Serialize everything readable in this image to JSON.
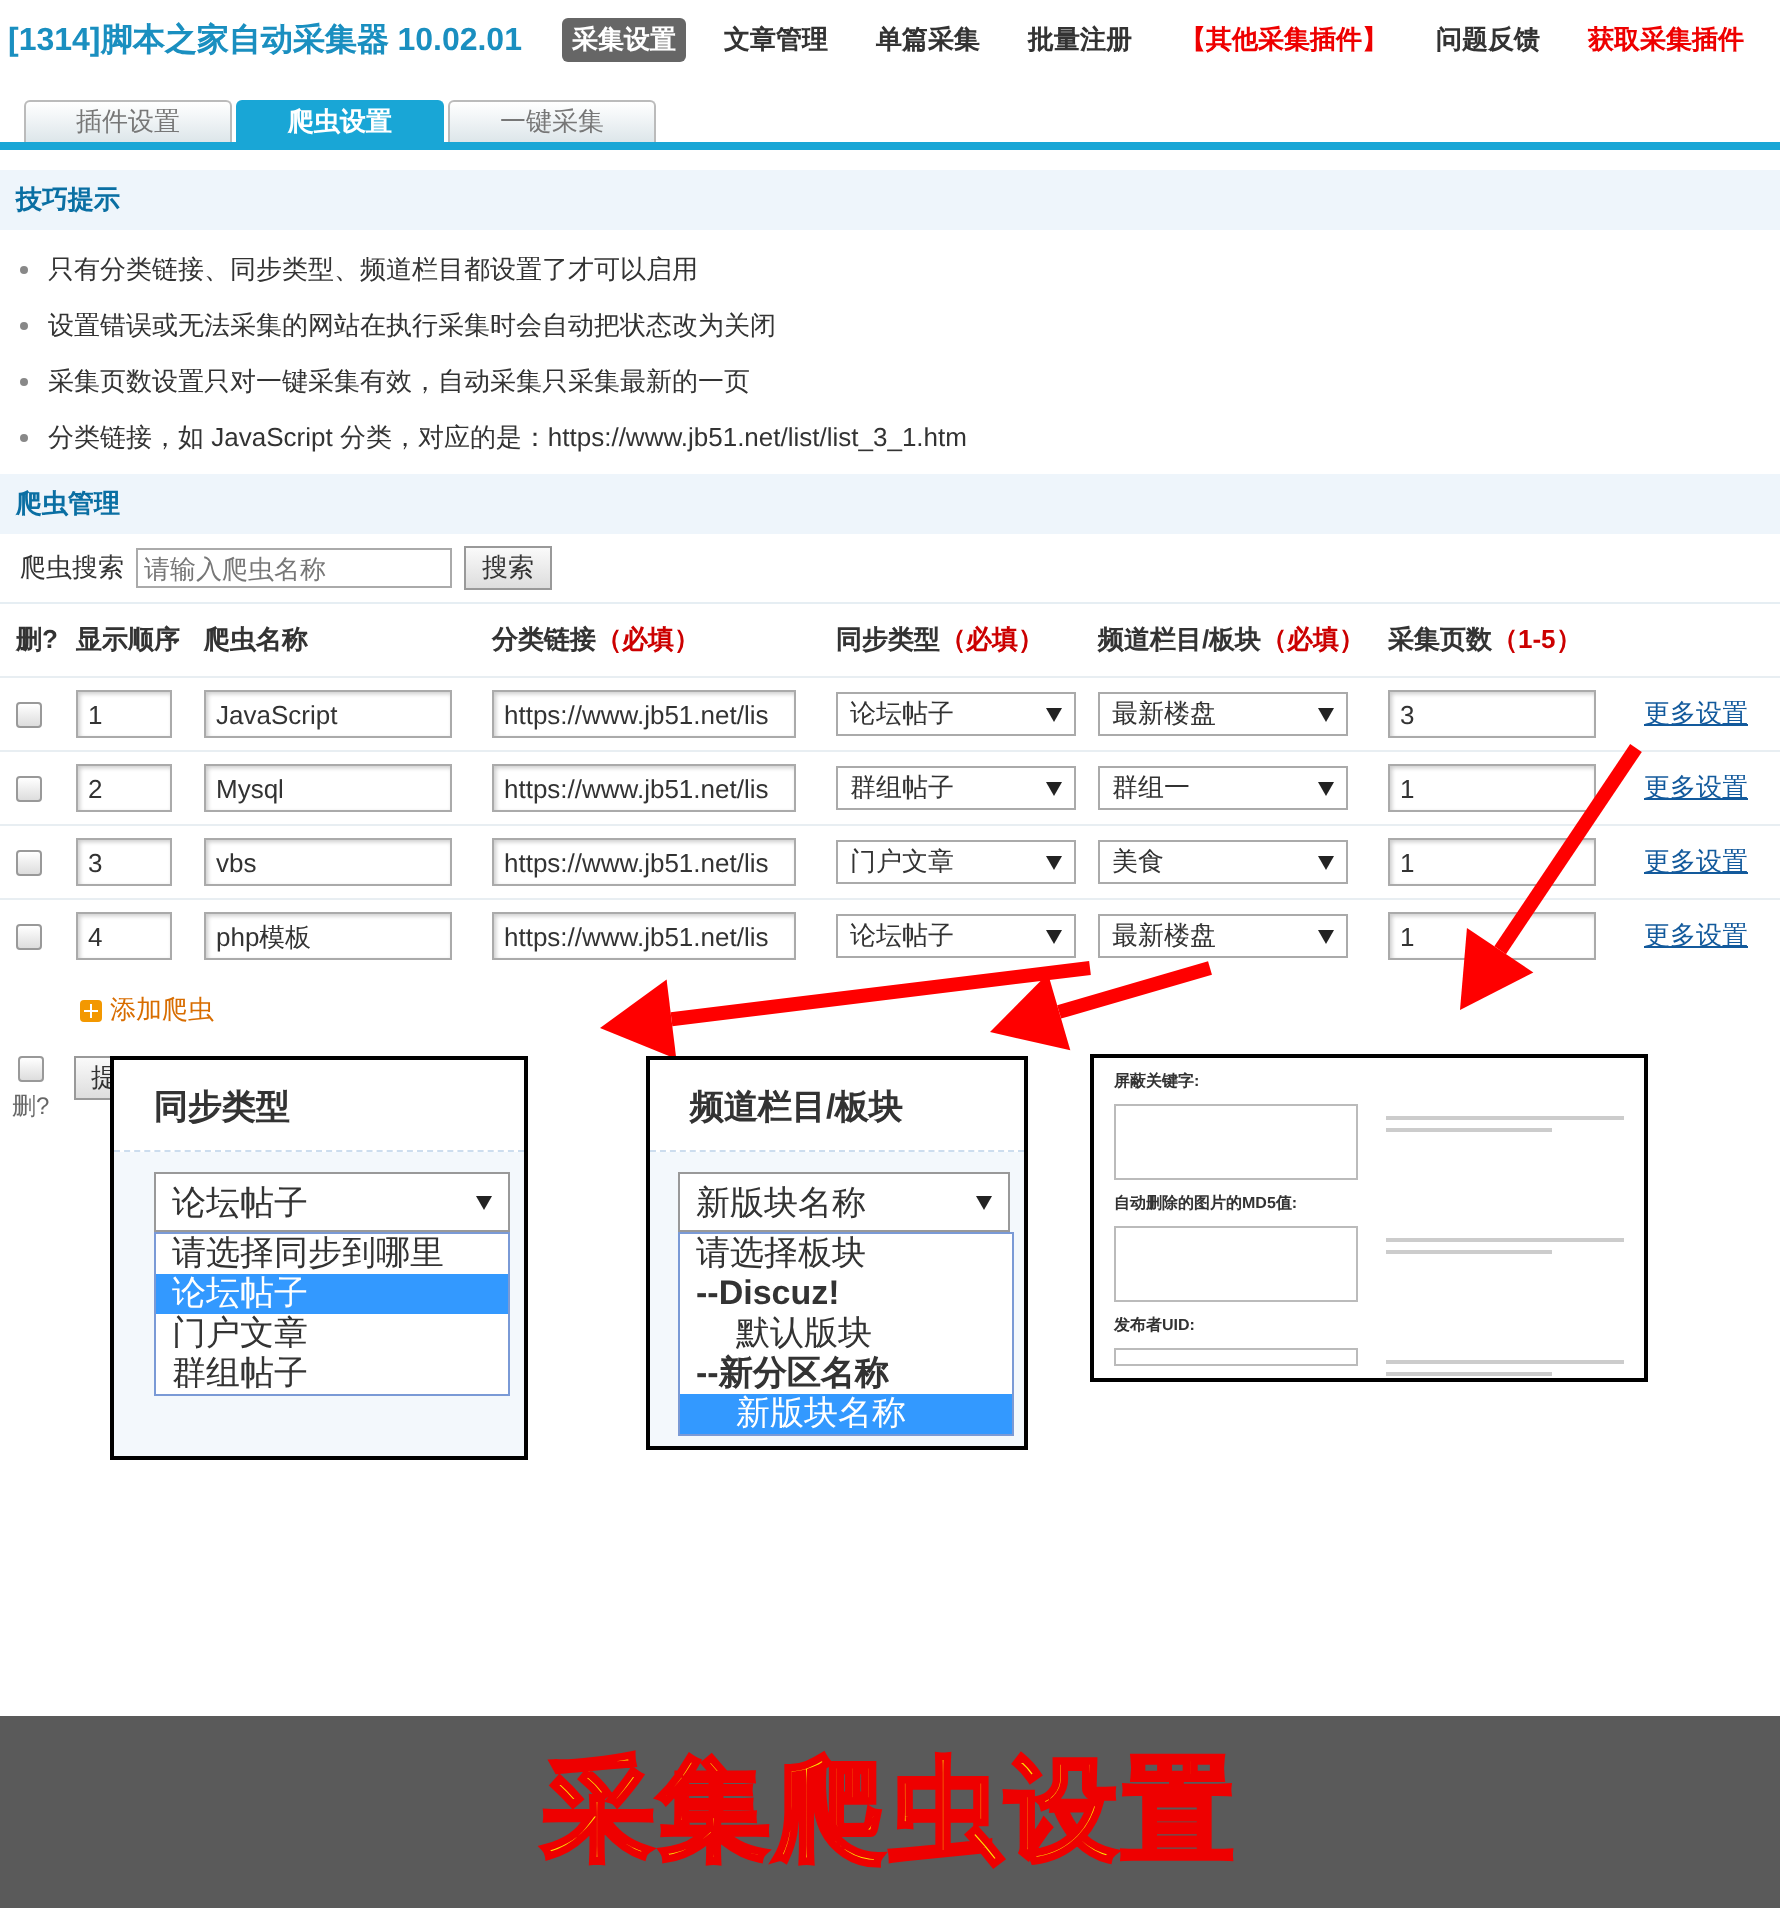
{
  "header": {
    "title": "[1314]脚本之家自动采集器 10.02.01",
    "nav": [
      {
        "label": "采集设置",
        "selected": true,
        "kind": "normal"
      },
      {
        "label": "文章管理",
        "selected": false,
        "kind": "normal"
      },
      {
        "label": "单篇采集",
        "selected": false,
        "kind": "normal"
      },
      {
        "label": "批量注册",
        "selected": false,
        "kind": "normal"
      },
      {
        "label": "【其他采集插件】",
        "selected": false,
        "kind": "promo"
      },
      {
        "label": "问题反馈",
        "selected": false,
        "kind": "normal"
      },
      {
        "label": "获取采集插件",
        "selected": false,
        "kind": "promo"
      }
    ]
  },
  "tabs": [
    {
      "label": "插件设置",
      "selected": false
    },
    {
      "label": "爬虫设置",
      "selected": true
    },
    {
      "label": "一键采集",
      "selected": false
    }
  ],
  "tips": {
    "title": "技巧提示",
    "items": [
      "只有分类链接、同步类型、频道栏目都设置了才可以启用",
      "设置错误或无法采集的网站在执行采集时会自动把状态改为关闭",
      "采集页数设置只对一键采集有效，自动采集只采集最新的一页",
      "分类链接，如 JavaScript 分类，对应的是：https://www.jb51.net/list/list_3_1.htm"
    ]
  },
  "manager": {
    "title": "爬虫管理",
    "search": {
      "label": "爬虫搜索",
      "placeholder": "请输入爬虫名称",
      "button": "搜索"
    },
    "columns": [
      {
        "label": "删?"
      },
      {
        "label": "显示顺序"
      },
      {
        "label": "爬虫名称"
      },
      {
        "label": "分类链接",
        "note": "（必填）"
      },
      {
        "label": "同步类型",
        "note": "（必填）"
      },
      {
        "label": "频道栏目/板块",
        "note": "（必填）"
      },
      {
        "label": "采集页数",
        "note": "（1-5）"
      }
    ],
    "rows": [
      {
        "checked": false,
        "order": "1",
        "name": "JavaScript",
        "url": "https://www.jb51.net/lis",
        "sync": "论坛帖子",
        "channel": "最新楼盘",
        "pages": "3",
        "more": "更多设置"
      },
      {
        "checked": false,
        "order": "2",
        "name": "Mysql",
        "url": "https://www.jb51.net/lis",
        "sync": "群组帖子",
        "channel": "群组一",
        "pages": "1",
        "more": "更多设置"
      },
      {
        "checked": false,
        "order": "3",
        "name": "vbs",
        "url": "https://www.jb51.net/lis",
        "sync": "门户文章",
        "channel": "美食",
        "pages": "1",
        "more": "更多设置"
      },
      {
        "checked": false,
        "order": "4",
        "name": "php模板",
        "url": "https://www.jb51.net/lis",
        "sync": "论坛帖子",
        "channel": "最新楼盘",
        "pages": "1",
        "more": "更多设置"
      }
    ],
    "add_label": "添加爬虫",
    "footer": {
      "checked": false,
      "delete_label": "删?",
      "submit_label": "提"
    }
  },
  "callouts": [
    {
      "kind": "dropdown",
      "title": "同步类型",
      "value": "论坛帖子",
      "options": [
        {
          "kind": "item",
          "label": "请选择同步到哪里",
          "selected": false
        },
        {
          "kind": "item",
          "label": "论坛帖子",
          "selected": true
        },
        {
          "kind": "item",
          "label": "门户文章",
          "selected": false
        },
        {
          "kind": "item",
          "label": "群组帖子",
          "selected": false
        }
      ]
    },
    {
      "kind": "dropdown",
      "title": "频道栏目/板块",
      "value": "新版块名称",
      "options": [
        {
          "kind": "item",
          "label": "请选择板块",
          "selected": false
        },
        {
          "kind": "group",
          "label": "--Discuz!",
          "selected": false,
          "children": [
            {
              "kind": "item",
              "label": "默认版块",
              "selected": false
            }
          ]
        },
        {
          "kind": "group",
          "label": "--新分区名称",
          "selected": false,
          "children": [
            {
              "kind": "item",
              "label": "新版块名称",
              "selected": true
            }
          ]
        }
      ]
    },
    {
      "kind": "form",
      "fields": [
        {
          "label": "屏蔽关键字:",
          "kind": "area"
        },
        {
          "label": "自动删除的图片的MD5值:",
          "kind": "area"
        },
        {
          "label": "发布者UID:",
          "kind": "line"
        }
      ]
    }
  ],
  "banner": {
    "text": "采集爬虫设置"
  }
}
